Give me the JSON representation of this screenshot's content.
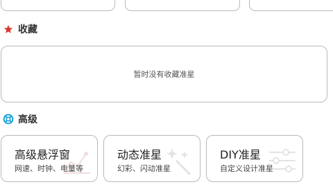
{
  "favorites": {
    "title": "收藏",
    "icon": "star-icon",
    "icon_color": "#d93a2f",
    "empty_text": "暂时没有收藏准星"
  },
  "advanced": {
    "title": "高级",
    "icon": "lifebuoy-icon",
    "icon_color": "#1aa3d9",
    "cards": [
      {
        "title": "高级悬浮窗",
        "subtitle": "网速、时钟、电量等",
        "icon": "chart-icon"
      },
      {
        "title": "动态准星",
        "subtitle": "幻彩、闪动准星",
        "icon": "sparkle-wand-icon"
      },
      {
        "title": "DIY准星",
        "subtitle": "自定义设计准星",
        "icon": "sliders-icon"
      }
    ]
  }
}
